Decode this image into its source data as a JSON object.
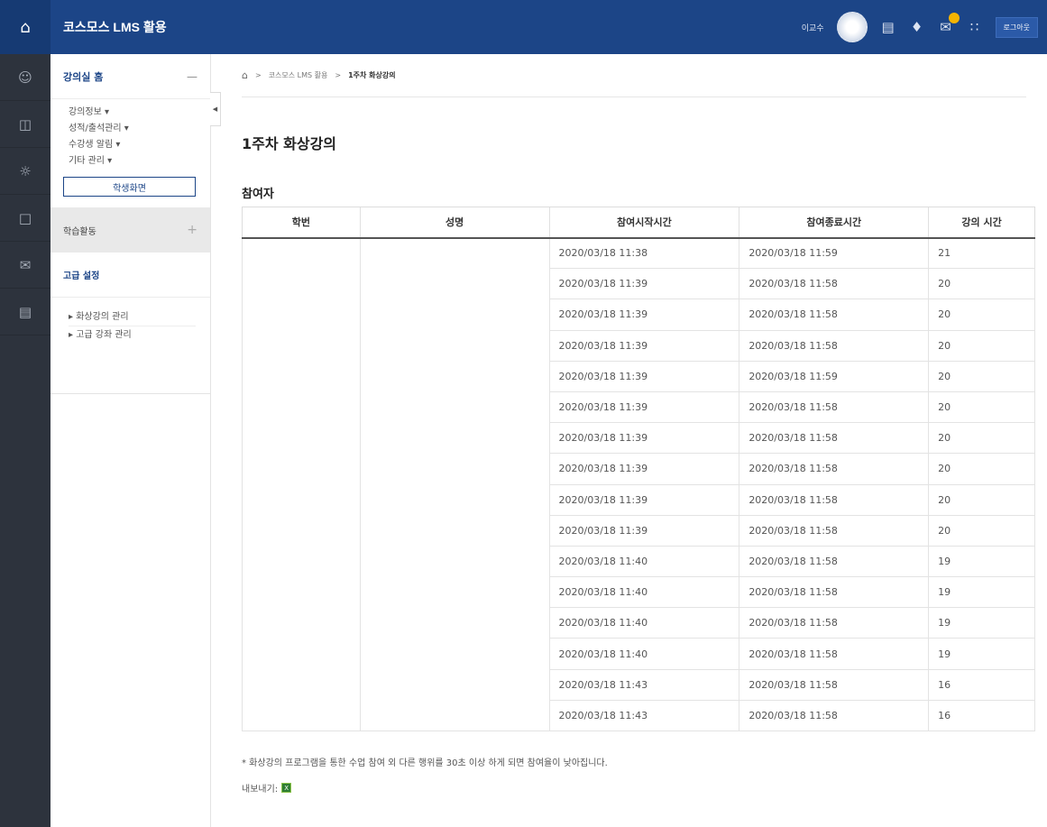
{
  "header": {
    "home_icon": "home-icon",
    "brand": "코스모스 LMS 활용",
    "user_name": "이교수",
    "logout": "로그아웃"
  },
  "rail_icons": [
    "person-icon",
    "book-icon",
    "people-icon",
    "open-book-icon",
    "mail-icon",
    "map-icon"
  ],
  "panel": {
    "home_title": "강의실 홈",
    "home_toggle": "—",
    "menu": [
      "강의정보 ▾",
      "성적/출석관리 ▾",
      "수강생 알림 ▾",
      "기타 관리 ▾"
    ],
    "student_view_button": "학생화면",
    "activity_title": "학습활동",
    "activity_toggle": "+",
    "advanced_title": "고급 설정",
    "advanced_items": [
      "▸ 화상강의 관리",
      "▸ 고급 강좌 관리"
    ]
  },
  "breadcrumb": {
    "sep": ">",
    "course": "코스모스 LMS 활용",
    "current": "1주차 화상강의"
  },
  "page_title": "1주차 화상강의",
  "section_title": "참여자",
  "table": {
    "columns": [
      "학번",
      "성명",
      "참여시작시간",
      "참여종료시간",
      "강의 시간"
    ],
    "rows": [
      [
        "",
        "",
        "2020/03/18 11:38",
        "2020/03/18 11:59",
        "21"
      ],
      [
        "",
        "",
        "2020/03/18 11:39",
        "2020/03/18 11:58",
        "20"
      ],
      [
        "",
        "",
        "2020/03/18 11:39",
        "2020/03/18 11:58",
        "20"
      ],
      [
        "",
        "",
        "2020/03/18 11:39",
        "2020/03/18 11:58",
        "20"
      ],
      [
        "",
        "",
        "2020/03/18 11:39",
        "2020/03/18 11:59",
        "20"
      ],
      [
        "",
        "",
        "2020/03/18 11:39",
        "2020/03/18 11:58",
        "20"
      ],
      [
        "",
        "",
        "2020/03/18 11:39",
        "2020/03/18 11:58",
        "20"
      ],
      [
        "",
        "",
        "2020/03/18 11:39",
        "2020/03/18 11:58",
        "20"
      ],
      [
        "",
        "",
        "2020/03/18 11:39",
        "2020/03/18 11:58",
        "20"
      ],
      [
        "",
        "",
        "2020/03/18 11:39",
        "2020/03/18 11:58",
        "20"
      ],
      [
        "",
        "",
        "2020/03/18 11:40",
        "2020/03/18 11:58",
        "19"
      ],
      [
        "",
        "",
        "2020/03/18 11:40",
        "2020/03/18 11:58",
        "19"
      ],
      [
        "",
        "",
        "2020/03/18 11:40",
        "2020/03/18 11:58",
        "19"
      ],
      [
        "",
        "",
        "2020/03/18 11:40",
        "2020/03/18 11:58",
        "19"
      ],
      [
        "",
        "",
        "2020/03/18 11:43",
        "2020/03/18 11:58",
        "16"
      ],
      [
        "",
        "",
        "2020/03/18 11:43",
        "2020/03/18 11:58",
        "16"
      ]
    ]
  },
  "note": "* 화상강의 프로그램을 통한 수업 참여 외 다른 행위를 30초 이상 하게 되면 참여율이 낮아집니다.",
  "export_label": "내보내기:",
  "colors": {
    "header": "#1c4587",
    "rail": "#2d333d",
    "accent": "#1c4587"
  }
}
